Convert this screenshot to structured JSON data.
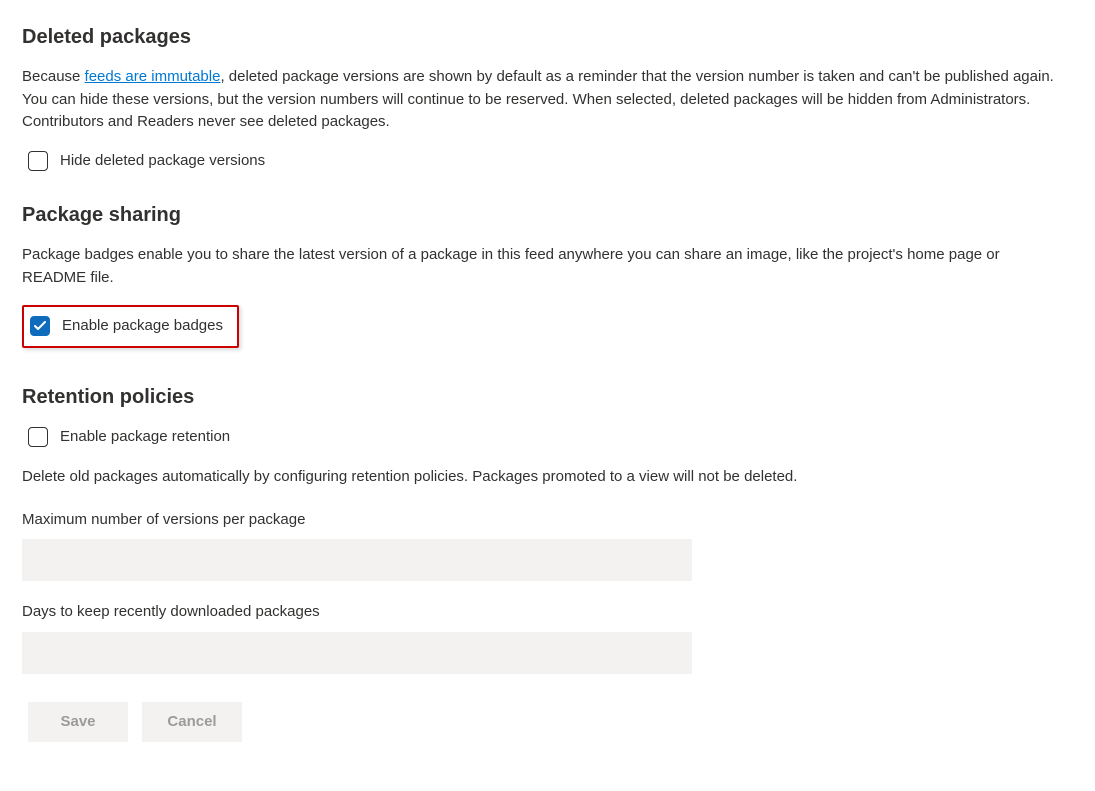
{
  "deleted": {
    "heading": "Deleted packages",
    "desc_before": "Because ",
    "link_text": "feeds are immutable",
    "desc_after": ", deleted package versions are shown by default as a reminder that the version number is taken and can't be published again. You can hide these versions, but the version numbers will continue to be reserved. When selected, deleted packages will be hidden from Administrators. Contributors and Readers never see deleted packages.",
    "hide_label": "Hide deleted package versions",
    "hide_checked": false
  },
  "sharing": {
    "heading": "Package sharing",
    "desc": "Package badges enable you to share the latest version of a package in this feed anywhere you can share an image, like the project's home page or README file.",
    "enable_label": "Enable package badges",
    "enable_checked": true
  },
  "retention": {
    "heading": "Retention policies",
    "enable_label": "Enable package retention",
    "enable_checked": false,
    "desc": "Delete old packages automatically by configuring retention policies. Packages promoted to a view will not be deleted.",
    "max_versions_label": "Maximum number of versions per package",
    "max_versions_value": "",
    "days_keep_label": "Days to keep recently downloaded packages",
    "days_keep_value": ""
  },
  "actions": {
    "save": "Save",
    "cancel": "Cancel"
  }
}
